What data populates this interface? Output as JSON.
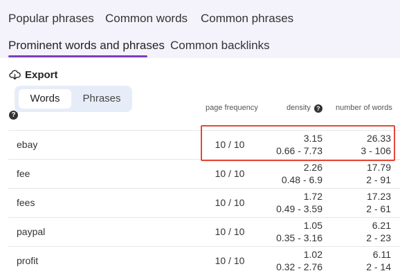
{
  "tabs": [
    {
      "label": "Popular phrases"
    },
    {
      "label": "Common words"
    },
    {
      "label": "Common phrases"
    },
    {
      "label": "Prominent words and phrases"
    },
    {
      "label": "Common backlinks"
    }
  ],
  "export": {
    "label": "Export",
    "icon": "download-icon"
  },
  "toggle": {
    "words_label": "Words",
    "phrases_label": "Phrases",
    "selected": "Words"
  },
  "help_glyph": "?",
  "columns": {
    "page_frequency": "page frequency",
    "density": "density",
    "number_of_words": "number of words"
  },
  "rows": [
    {
      "word": "ebay",
      "freq": "10 / 10",
      "density": "3.15",
      "density_range": "0.66 - 7.73",
      "words": "26.33",
      "words_range": "3 - 106"
    },
    {
      "word": "fee",
      "freq": "10 / 10",
      "density": "2.26",
      "density_range": "0.48 - 6.9",
      "words": "17.79",
      "words_range": "2 - 91"
    },
    {
      "word": "fees",
      "freq": "10 / 10",
      "density": "1.72",
      "density_range": "0.49 - 3.59",
      "words": "17.23",
      "words_range": "2 - 61"
    },
    {
      "word": "paypal",
      "freq": "10 / 10",
      "density": "1.05",
      "density_range": "0.35 - 3.16",
      "words": "6.21",
      "words_range": "2 - 23"
    },
    {
      "word": "profit",
      "freq": "10 / 10",
      "density": "1.02",
      "density_range": "0.32 - 2.76",
      "words": "6.11",
      "words_range": "2 - 14"
    }
  ],
  "colors": {
    "accent": "#7a3fbf",
    "highlight": "#e2483a",
    "tab_bg": "#f4f2fb"
  }
}
